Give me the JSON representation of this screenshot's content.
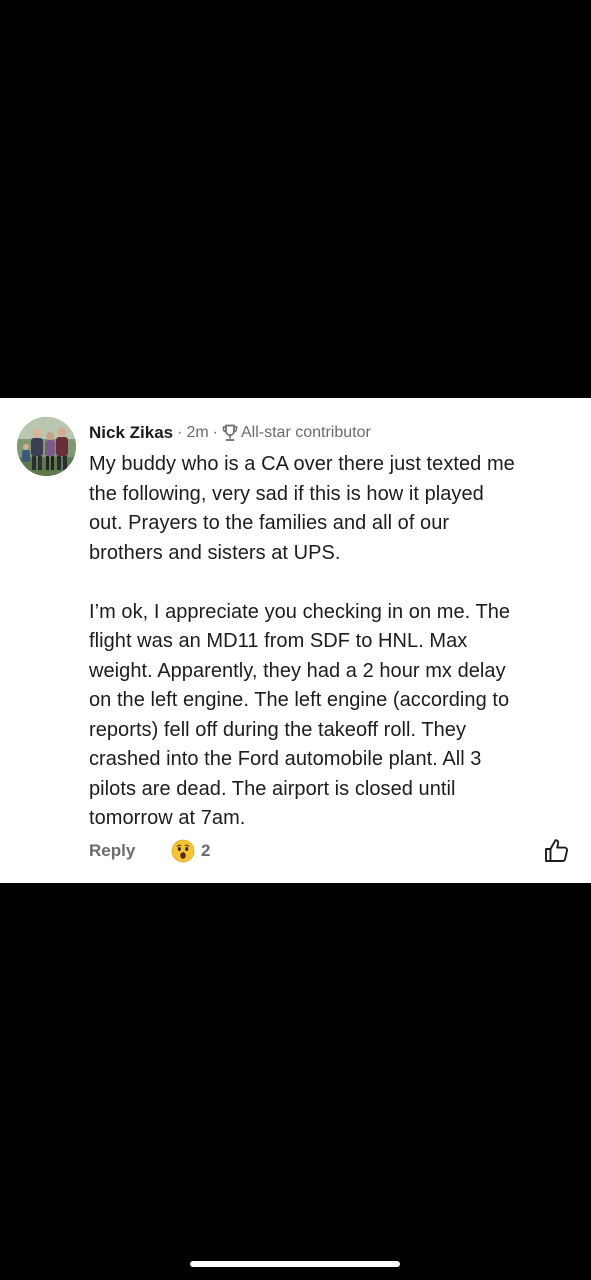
{
  "comment": {
    "author": "Nick Zikas",
    "separator": "·",
    "time": "2m",
    "badge": "All-star contributor",
    "badge_icon": "trophy-icon",
    "paragraph_1": [
      "My buddy who is a CA over there just texted me",
      "the following, very sad if this is how it played",
      "out. Prayers to the families and all of our",
      "brothers and sisters at UPS."
    ],
    "paragraph_2": [
      "I’m ok, I appreciate you checking in on me. The",
      "flight was an MD11 from SDF to HNL. Max",
      "weight. Apparently, they had a 2 hour mx delay",
      "on the left engine. The left engine (according to",
      "reports) fell off during the takeoff roll. They",
      "crashed into the Ford automobile plant. All 3",
      "pilots are dead. The airport is closed until",
      "tomorrow at 7am."
    ]
  },
  "actions": {
    "reply_label": "Reply",
    "reaction_icon": "wow-emoji-icon",
    "reaction_count": "2",
    "like_icon": "thumbs-up-icon"
  },
  "colors": {
    "background": "#000000",
    "card": "#ffffff",
    "text": "#1c1c1c",
    "muted": "#6b6b6b"
  }
}
